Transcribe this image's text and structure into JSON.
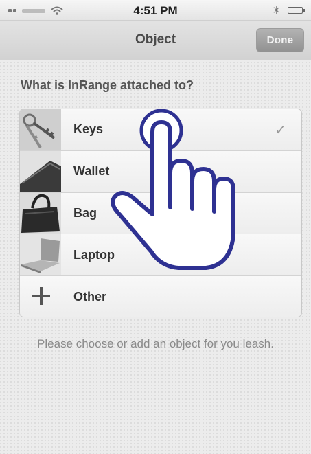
{
  "status_bar": {
    "time": "4:51 PM",
    "wifi_icon": "wifi-icon",
    "bluetooth_icon": "bluetooth-icon",
    "bluetooth_glyph": "✳",
    "battery_icon": "battery-icon"
  },
  "nav_bar": {
    "title": "Object",
    "done_label": "Done"
  },
  "question": "What is InRange attached to?",
  "objects": [
    {
      "label": "Keys",
      "icon": "keys-photo-icon",
      "selected": true
    },
    {
      "label": "Wallet",
      "icon": "wallet-photo-icon",
      "selected": false
    },
    {
      "label": "Bag",
      "icon": "bag-photo-icon",
      "selected": false
    },
    {
      "label": "Laptop",
      "icon": "laptop-photo-icon",
      "selected": false
    },
    {
      "label": "Other",
      "icon": "plus-icon",
      "selected": false
    }
  ],
  "check_glyph": "✓",
  "hint": "Please choose or add an object for you leash.",
  "colors": {
    "background": "#ececec",
    "nav_bar": "#d9d9d9",
    "done_button": "#a3a3a3",
    "hand_outline": "#2e3192"
  },
  "overlay": {
    "icon": "tap-hand-icon"
  }
}
